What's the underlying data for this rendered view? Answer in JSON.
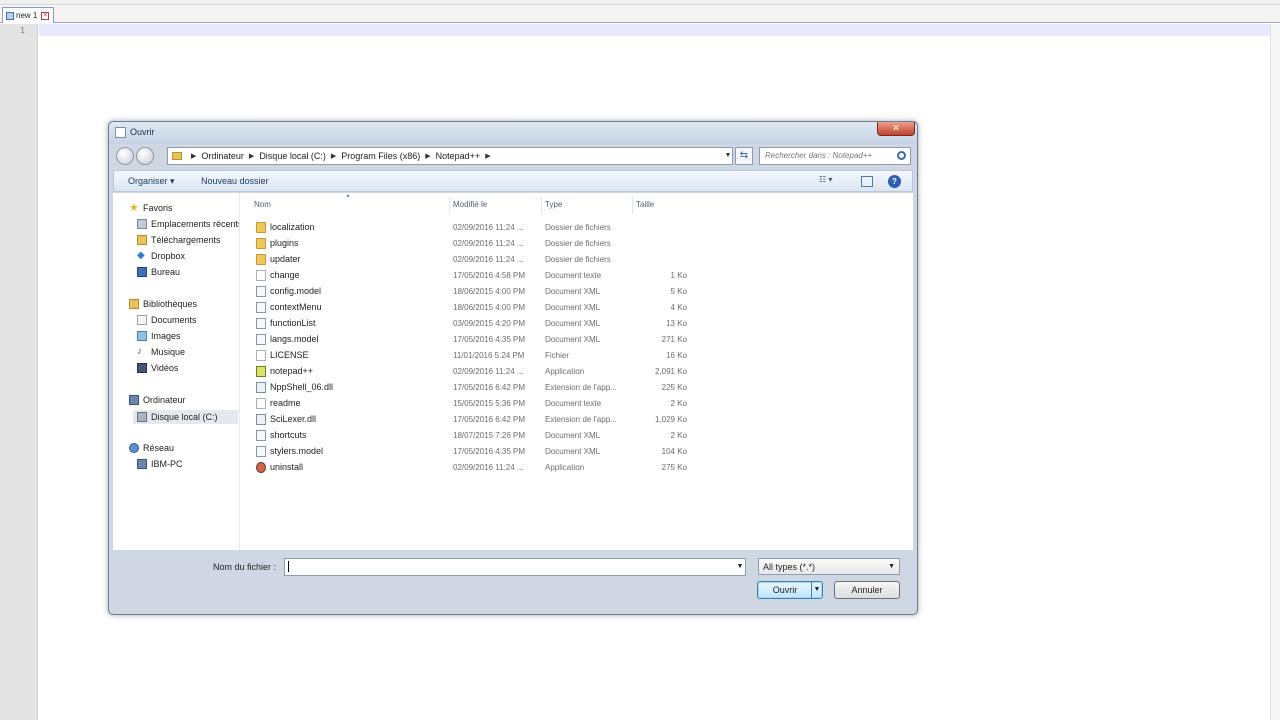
{
  "editor": {
    "tab_label": "new 1",
    "line_number": "1"
  },
  "dialog": {
    "title": "Ouvrir",
    "close_glyph": "✕",
    "breadcrumbs": [
      "Ordinateur",
      "Disque local (C:)",
      "Program Files (x86)",
      "Notepad++"
    ],
    "search_placeholder": "Rechercher dans : Notepad++",
    "toolbar": {
      "organiser": "Organiser ▾",
      "new_folder": "Nouveau dossier",
      "views_glyph": "☷ ▾",
      "help_glyph": "?"
    },
    "nav": {
      "favorites_header": "Favoris",
      "favorites": [
        "Emplacements récents",
        "Téléchargements",
        "Dropbox",
        "Bureau"
      ],
      "libraries_header": "Bibliothèques",
      "libraries": [
        "Documents",
        "Images",
        "Musique",
        "Vidéos"
      ],
      "computer_header": "Ordinateur",
      "computer": [
        "Disque local (C:)"
      ],
      "network_header": "Réseau",
      "network": [
        "IBM-PC"
      ]
    },
    "columns": {
      "name": "Nom",
      "modified": "Modifié le",
      "type": "Type",
      "size": "Taille"
    },
    "files": [
      {
        "name": "localization",
        "date": "02/09/2016 11:24 ...",
        "type": "Dossier de fichiers",
        "size": "",
        "icon": "folder-icon"
      },
      {
        "name": "plugins",
        "date": "02/09/2016 11:24 ...",
        "type": "Dossier de fichiers",
        "size": "",
        "icon": "folder-icon"
      },
      {
        "name": "updater",
        "date": "02/09/2016 11:24 ...",
        "type": "Dossier de fichiers",
        "size": "",
        "icon": "folder-icon"
      },
      {
        "name": "change",
        "date": "17/05/2016 4:58 PM",
        "type": "Document texte",
        "size": "1 Ko",
        "icon": "text-file-icon"
      },
      {
        "name": "config.model",
        "date": "18/06/2015 4:00 PM",
        "type": "Document XML",
        "size": "5 Ko",
        "icon": "xml-file-icon"
      },
      {
        "name": "contextMenu",
        "date": "18/06/2015 4:00 PM",
        "type": "Document XML",
        "size": "4 Ko",
        "icon": "xml-file-icon"
      },
      {
        "name": "functionList",
        "date": "03/09/2015 4:20 PM",
        "type": "Document XML",
        "size": "13 Ko",
        "icon": "xml-file-icon"
      },
      {
        "name": "langs.model",
        "date": "17/05/2016 4:35 PM",
        "type": "Document XML",
        "size": "271 Ko",
        "icon": "xml-file-icon"
      },
      {
        "name": "LICENSE",
        "date": "11/01/2016 5:24 PM",
        "type": "Fichier",
        "size": "16 Ko",
        "icon": "file-icon"
      },
      {
        "name": "notepad++",
        "date": "02/09/2016 11:24 ...",
        "type": "Application",
        "size": "2,091 Ko",
        "icon": "notepad-app-icon"
      },
      {
        "name": "NppShell_06.dll",
        "date": "17/05/2016 6:42 PM",
        "type": "Extension de l'app...",
        "size": "225 Ko",
        "icon": "dll-file-icon"
      },
      {
        "name": "readme",
        "date": "15/05/2015 5:36 PM",
        "type": "Document texte",
        "size": "2 Ko",
        "icon": "text-file-icon"
      },
      {
        "name": "SciLexer.dll",
        "date": "17/05/2016 6:42 PM",
        "type": "Extension de l'app...",
        "size": "1,029 Ko",
        "icon": "dll-file-icon"
      },
      {
        "name": "shortcuts",
        "date": "18/07/2015 7:26 PM",
        "type": "Document XML",
        "size": "2 Ko",
        "icon": "xml-file-icon"
      },
      {
        "name": "stylers.model",
        "date": "17/05/2016 4:35 PM",
        "type": "Document XML",
        "size": "104 Ko",
        "icon": "xml-file-icon"
      },
      {
        "name": "uninstall",
        "date": "02/09/2016 11:24 ...",
        "type": "Application",
        "size": "275 Ko",
        "icon": "uninstall-app-icon"
      }
    ],
    "filename_label": "Nom du fichier :",
    "filename_value": "",
    "filetype_value": "All types (*.*)",
    "open_label": "Ouvrir",
    "cancel_label": "Annuler"
  }
}
